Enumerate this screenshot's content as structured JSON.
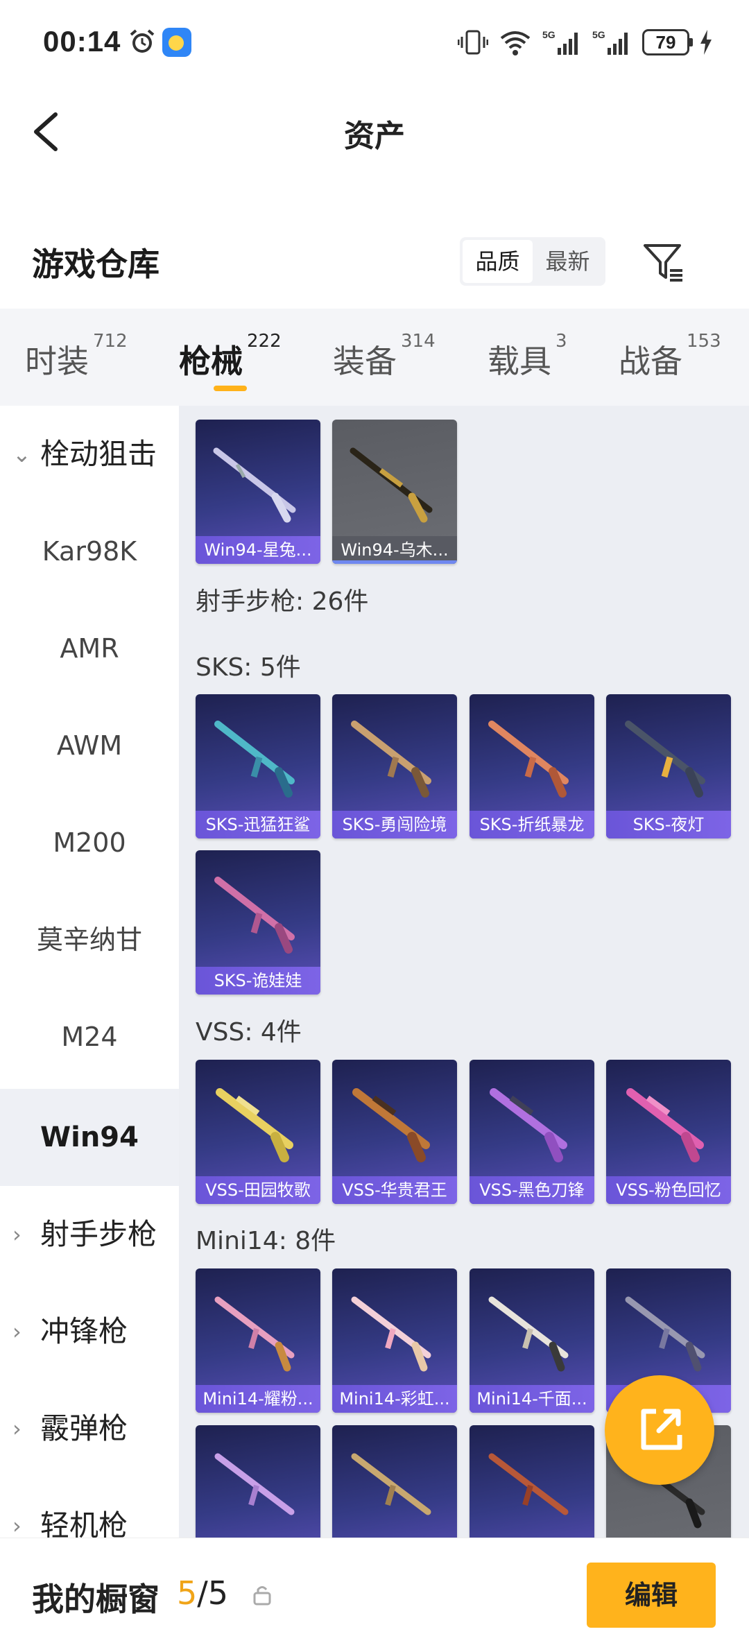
{
  "status_bar": {
    "time": "00:14",
    "battery": "79"
  },
  "header": {
    "title": "资产"
  },
  "warehouse": {
    "title": "游戏仓库",
    "sort_options": [
      "品质",
      "最新"
    ],
    "sort_active": "品质"
  },
  "tabs": [
    {
      "label": "时装",
      "count": "712"
    },
    {
      "label": "枪械",
      "count": "222"
    },
    {
      "label": "装备",
      "count": "314"
    },
    {
      "label": "载具",
      "count": "3"
    },
    {
      "label": "战备",
      "count": "153"
    }
  ],
  "active_tab": "枪械",
  "sidebar": {
    "category_open": "栓动狙击",
    "items": [
      "Kar98K",
      "AMR",
      "AWM",
      "M200",
      "莫辛纳甘",
      "M24",
      "Win94"
    ],
    "selected": "Win94",
    "categories_collapsed": [
      "射手步枪",
      "冲锋枪",
      "霰弹枪",
      "轻机枪"
    ]
  },
  "content": {
    "win94_items": [
      "Win94-星兔...",
      "Win94-乌木..."
    ],
    "marksman_header": "射手步枪: 26件",
    "sks_header": "SKS: 5件",
    "sks_items": [
      "SKS-迅猛狂鲨",
      "SKS-勇闯险境",
      "SKS-折纸暴龙",
      "SKS-夜灯",
      "SKS-诡娃娃"
    ],
    "vss_header": "VSS: 4件",
    "vss_items": [
      "VSS-田园牧歌",
      "VSS-华贵君王",
      "VSS-黑色刀锋",
      "VSS-粉色回忆"
    ],
    "mini14_header": "Mini14: 8件",
    "mini14_items": [
      "Mini14-耀粉...",
      "Mini14-彩虹...",
      "Mini14-千面...",
      "...夜..."
    ]
  },
  "showcase": {
    "label": "我的橱窗",
    "current": "5",
    "total": "/5",
    "edit_label": "编辑"
  },
  "colors": {
    "accent": "#ffb31c",
    "card_label": "#7560e0",
    "card_bg": "#2c3070"
  }
}
